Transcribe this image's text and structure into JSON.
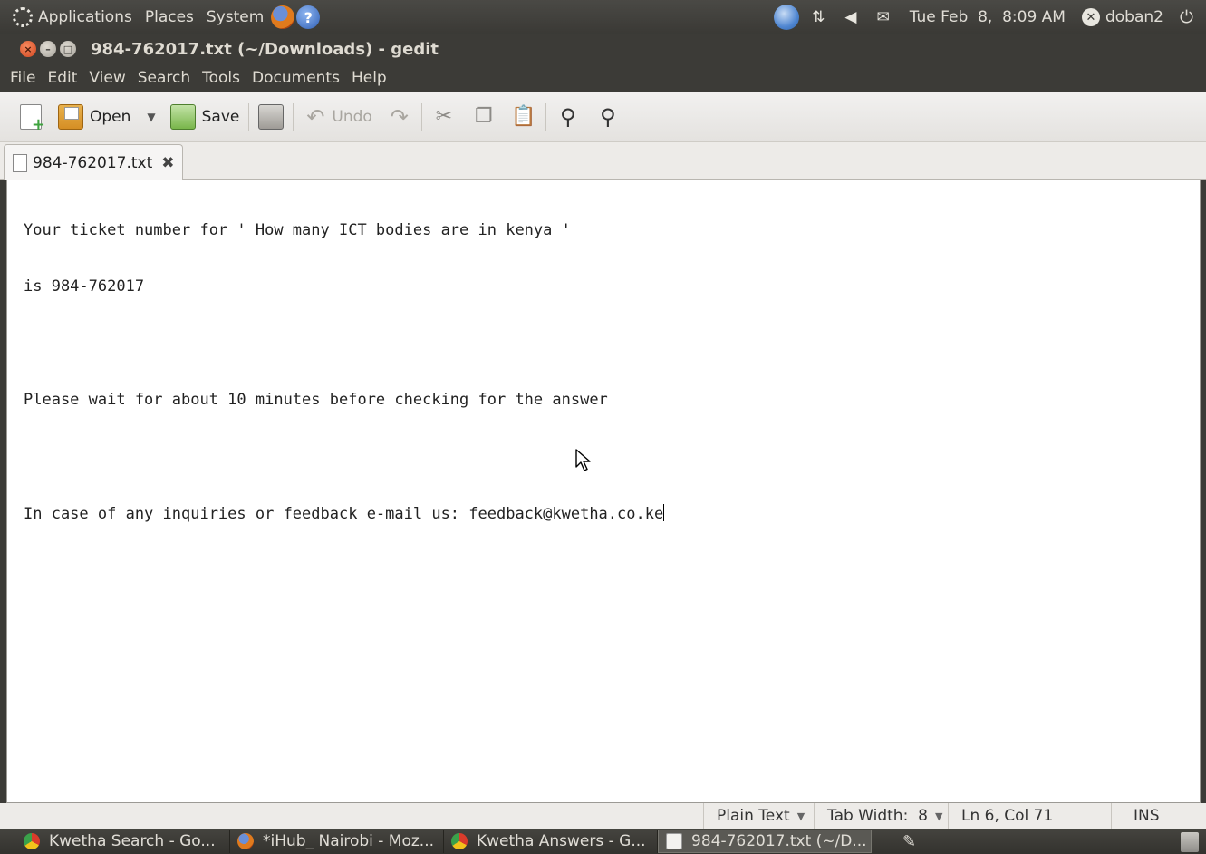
{
  "top_panel": {
    "menus": [
      "Applications",
      "Places",
      "System"
    ],
    "clock": "Tue Feb  8,  8:09 AM",
    "user": "doban2",
    "icons": [
      "ubuntu-logo-icon",
      "firefox-icon",
      "help-icon",
      "network-globe-icon",
      "network-arrows-icon",
      "volume-icon",
      "mail-icon",
      "user-icon",
      "power-icon"
    ]
  },
  "window": {
    "title": "984-762017.txt (~/Downloads) - gedit"
  },
  "menubar": [
    "File",
    "Edit",
    "View",
    "Search",
    "Tools",
    "Documents",
    "Help"
  ],
  "toolbar": {
    "open_label": "Open",
    "save_label": "Save",
    "undo_label": "Undo"
  },
  "tab": {
    "label": "984-762017.txt"
  },
  "editor": {
    "lines": [
      "Your ticket number for ' How many ICT bodies are in kenya '",
      "is 984-762017",
      "",
      "Please wait for about 10 minutes before checking for the answer",
      "",
      "In case of any inquiries or feedback e-mail us: feedback@kwetha.co.ke"
    ]
  },
  "status_bar": {
    "language": "Plain Text",
    "tab_width": "Tab Width:  8",
    "position": "Ln 6, Col 71",
    "mode": "INS"
  },
  "taskbar": {
    "tasks": [
      {
        "label": "Kwetha Search - Go...",
        "icon": "chrome-icon"
      },
      {
        "label": "*iHub_ Nairobi - Moz...",
        "icon": "firefox-icon"
      },
      {
        "label": "Kwetha Answers - G...",
        "icon": "chrome-icon"
      },
      {
        "label": "984-762017.txt (~/D...",
        "icon": "gedit-icon"
      }
    ]
  }
}
